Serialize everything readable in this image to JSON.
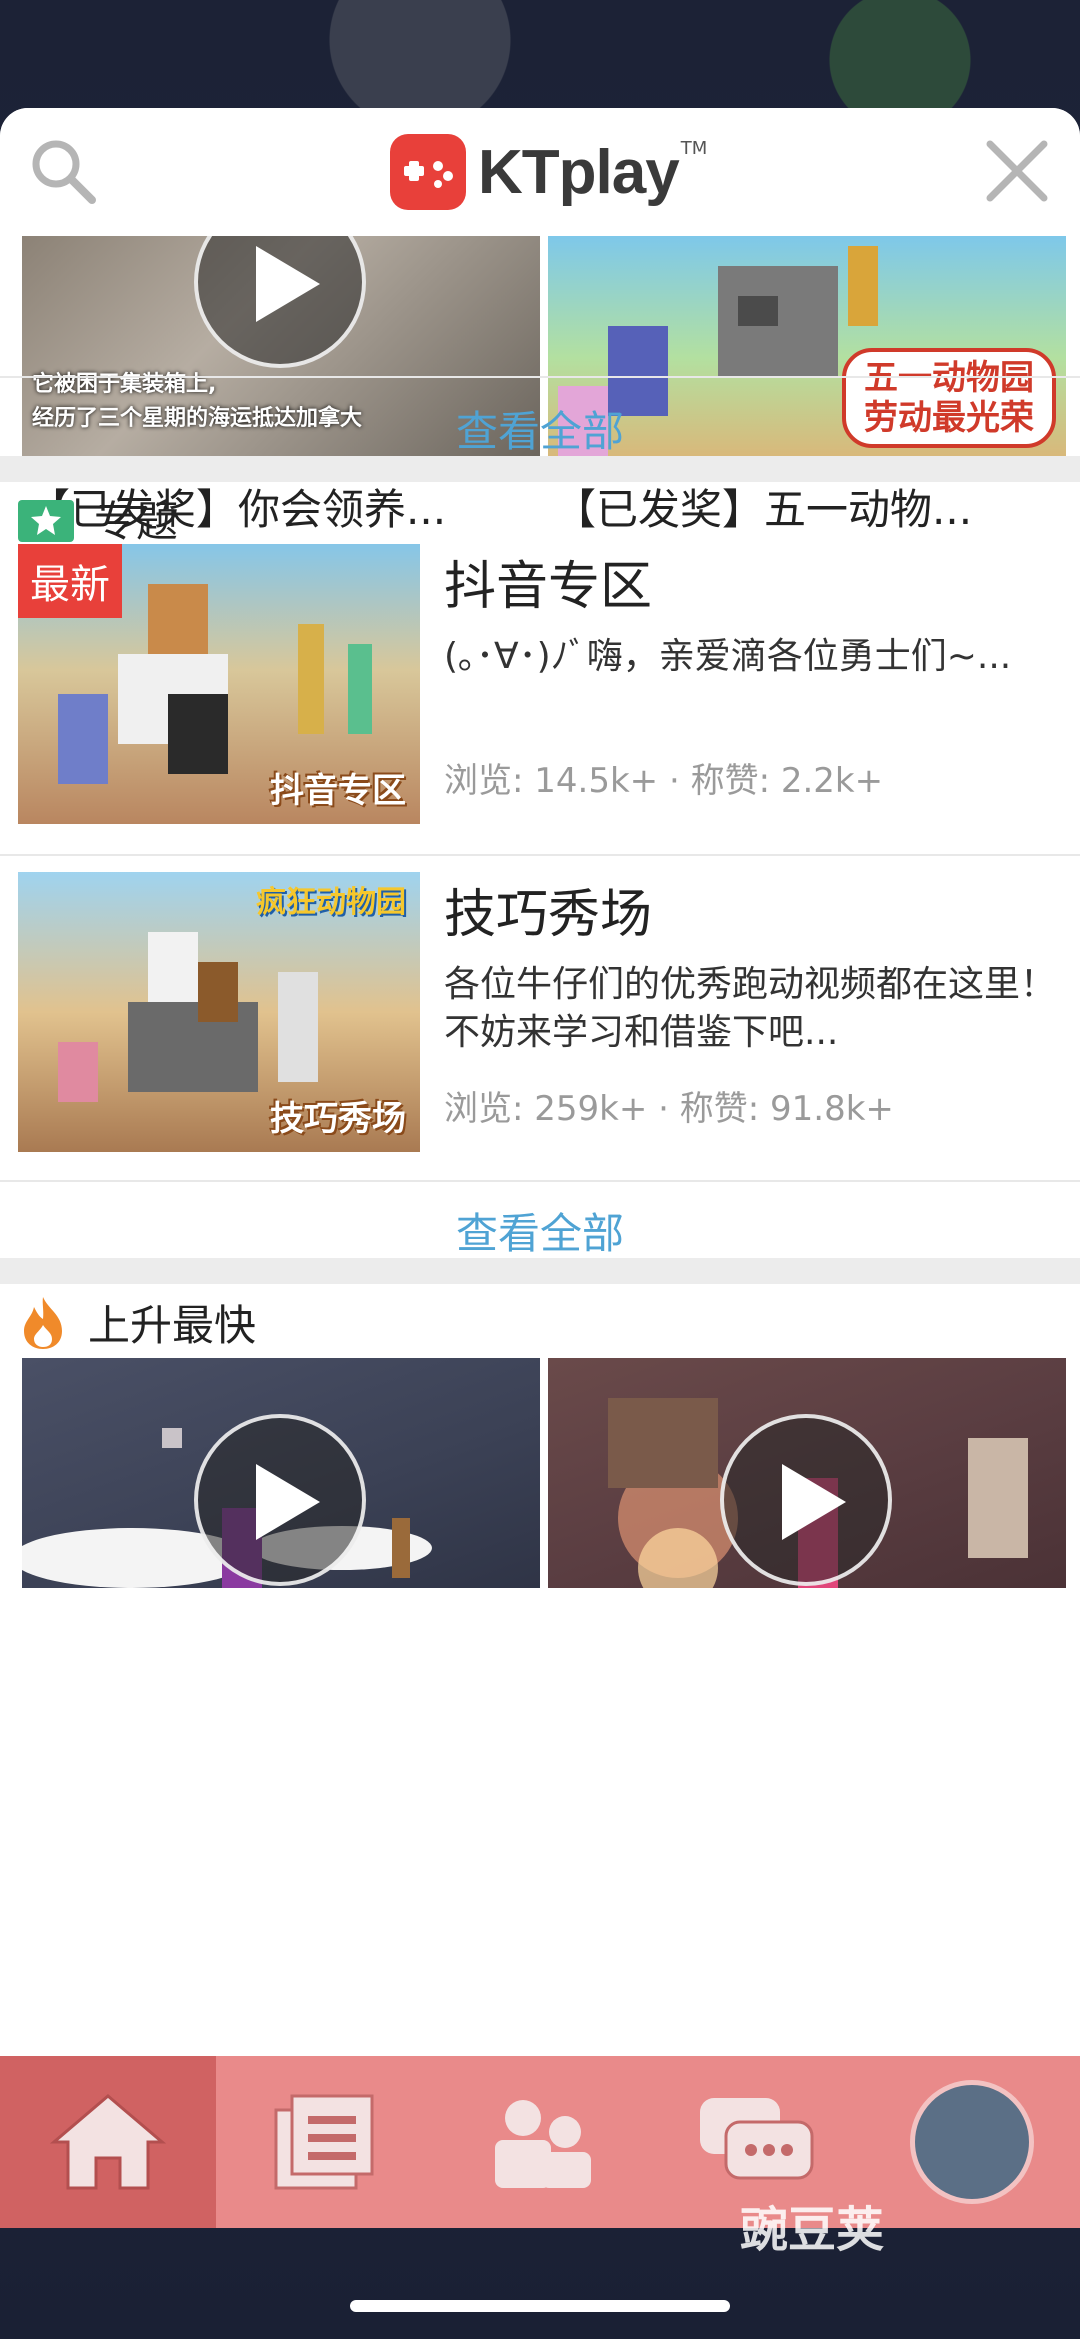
{
  "header": {
    "brand": "KTplay",
    "trademark": "TM"
  },
  "featured_videos": [
    {
      "title": "【已发奖】你会领养...",
      "caption_line1": "它被困于集装箱上,",
      "caption_line2": "经历了三个星期的海运抵达加拿大"
    },
    {
      "title": "【已发奖】五一动物...",
      "badge_line1": "五一动物园",
      "badge_line2": "劳动最光荣"
    }
  ],
  "view_all_label": "查看全部",
  "topics_section": {
    "heading": "专题",
    "items": [
      {
        "tag": "最新",
        "thumb_label": "抖音专区",
        "title": "抖音专区",
        "desc": "(｡･∀･)ﾉﾞ嗨，亲爱滴各位勇士们~...",
        "stats": "浏览: 14.5k+ · 称赞: 2.2k+"
      },
      {
        "tag": "",
        "thumb_label": "技巧秀场",
        "thumb_sub": "疯狂动物园",
        "title": "技巧秀场",
        "desc": "各位牛仔们的优秀跑动视频都在这里！不妨来学习和借鉴下吧...",
        "stats": "浏览: 259k+ · 称赞: 91.8k+"
      }
    ]
  },
  "rising_section": {
    "heading": "上升最快"
  },
  "tabbar": {
    "active_index": 0,
    "items": [
      "home-icon",
      "topics-icon",
      "friends-icon",
      "chat-icon",
      "profile-avatar"
    ]
  },
  "watermark": "豌豆荚",
  "colors": {
    "accent": "#e8403a",
    "link": "#4fa3d4",
    "tabbar": "#e98a8a",
    "tabbar_active": "#d06262"
  }
}
